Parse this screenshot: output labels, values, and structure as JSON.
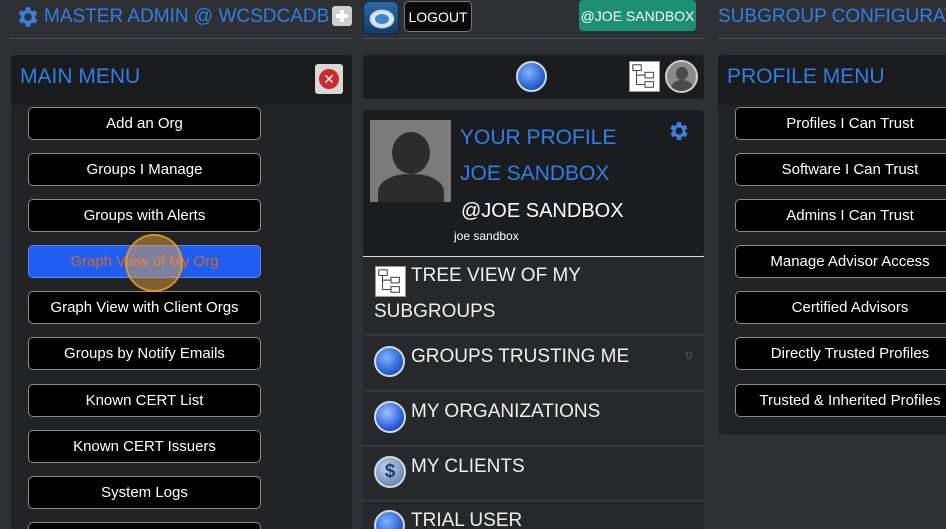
{
  "header": {
    "master_title": "MASTER ADMIN @ WCSDCADB",
    "logout_label": "LOGOUT",
    "user_badge": "@JOE SANDBOX",
    "subgroup_title": "SUBGROUP CONFIGURATIO"
  },
  "main_menu": {
    "title": "MAIN MENU",
    "items": [
      {
        "label": "Add an Org"
      },
      {
        "label": "Groups I Manage"
      },
      {
        "label": "Groups with Alerts"
      },
      {
        "label": "Graph View of My Org",
        "active": true
      },
      {
        "label": "Graph View with Client Orgs"
      },
      {
        "label": "Groups by Notify Emails"
      },
      {
        "label": "Known CERT List"
      },
      {
        "label": "Known CERT Issuers"
      },
      {
        "label": "System Logs"
      }
    ]
  },
  "profile": {
    "heading": "YOUR PROFILE",
    "name": "JOE SANDBOX",
    "handle": "@JOE SANDBOX",
    "username": "joe sandbox"
  },
  "middle_list": [
    {
      "label": "TREE VIEW OF MY",
      "label2": "SUBGROUPS",
      "icon": "tree-icon"
    },
    {
      "label": "GROUPS TRUSTING ME",
      "count": "0",
      "icon": "people-icon"
    },
    {
      "label": "MY ORGANIZATIONS",
      "icon": "org-icon"
    },
    {
      "label": "MY CLIENTS",
      "icon": "dollar-icon"
    },
    {
      "label": "TRIAL USER",
      "icon": "people-icon"
    }
  ],
  "profile_menu": {
    "title": "PROFILE MENU",
    "items": [
      {
        "label": "Profiles I Can Trust"
      },
      {
        "label": "Software I Can Trust"
      },
      {
        "label": "Admins I Can Trust"
      },
      {
        "label": "Manage Advisor Access"
      },
      {
        "label": "Certified Advisors"
      },
      {
        "label": "Directly Trusted Profiles"
      },
      {
        "label": "Trusted & Inherited Profiles"
      }
    ]
  },
  "colors": {
    "accent_blue": "#2f7fe6",
    "badge_green": "#1d8f72",
    "active_button": "#1f5ef0",
    "close_red": "#cc2a2a"
  }
}
